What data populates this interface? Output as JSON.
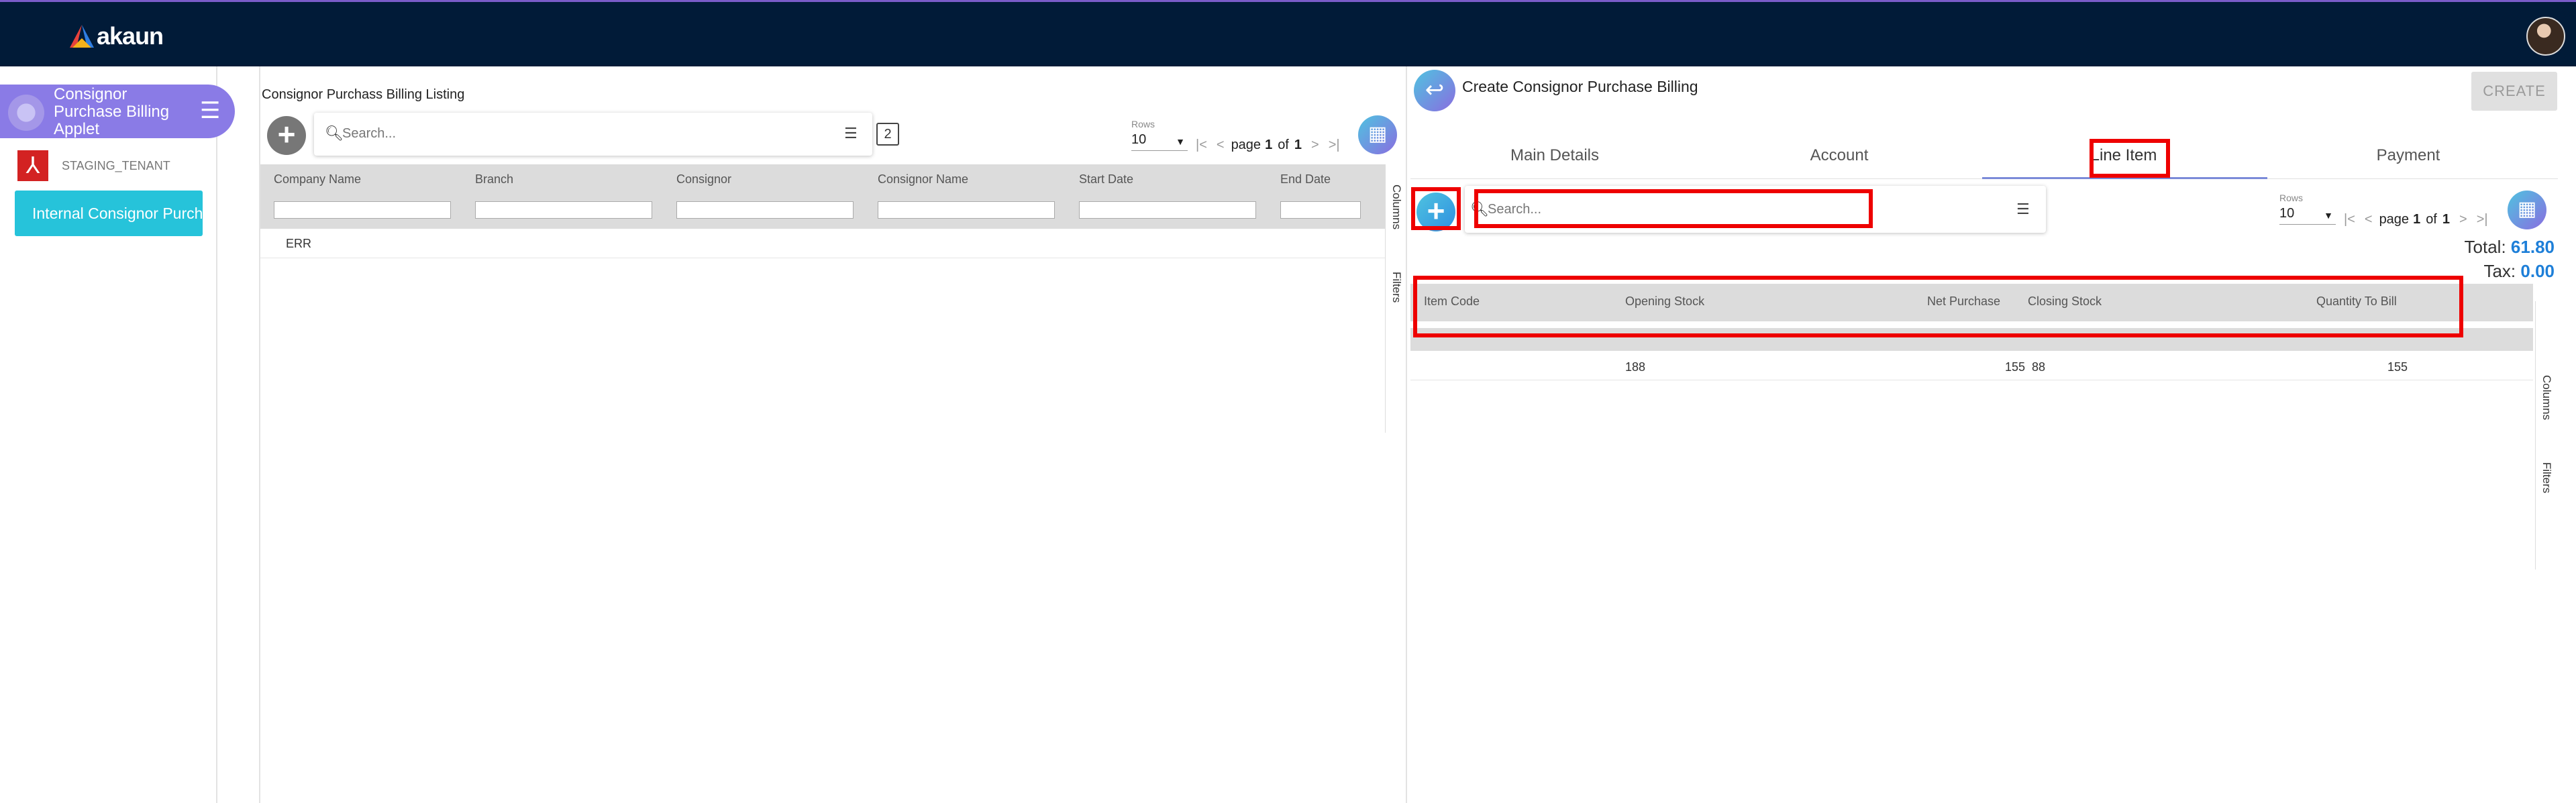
{
  "app": {
    "logo_text": "akaun"
  },
  "sidebar": {
    "applet_title": "Consignor Purchase Billing Applet",
    "tenant": "STAGING_TENANT",
    "nav_button": "Internal Consignor Purchase Billing"
  },
  "listing": {
    "title": "Consignor Purchass Billing Listing",
    "search_placeholder": "Search...",
    "rows_label": "Rows",
    "rows_value": "10",
    "page_word": "page",
    "page_current": "1",
    "of_word": "of",
    "page_total": "1",
    "columns": [
      "Company Name",
      "Branch",
      "Consignor",
      "Consignor Name",
      "Start Date",
      "End Date"
    ],
    "rows": [
      [
        "ERR"
      ]
    ],
    "side_tabs": [
      "Columns",
      "Filters"
    ]
  },
  "panel": {
    "title": "Create Consignor Purchase Billing",
    "create_label": "CREATE",
    "tabs": [
      "Main Details",
      "Account",
      "Line Item",
      "Payment"
    ],
    "active_tab": "Line Item",
    "search_placeholder": "Search...",
    "rows_label": "Rows",
    "rows_value": "10",
    "page_word": "page",
    "page_current": "1",
    "of_word": "of",
    "page_total": "1",
    "total_label": "Total:",
    "total_value": "61.80",
    "tax_label": "Tax:",
    "tax_value": "0.00",
    "columns": [
      "Item Code",
      "Opening Stock",
      "Net Purchase",
      "Closing Stock",
      "Quantity To Bill"
    ],
    "rows": [
      {
        "item_code": "",
        "opening_stock": "188",
        "net_purchase": "155",
        "closing_stock": "88",
        "quantity_to_bill": "155"
      }
    ],
    "side_tabs": [
      "Columns",
      "Filters"
    ]
  },
  "colors": {
    "topbar": "#011b38",
    "applet": "#8a7be6",
    "nav_button": "#26c3da",
    "highlight": "#ee0000",
    "total": "#1e7fd8"
  }
}
